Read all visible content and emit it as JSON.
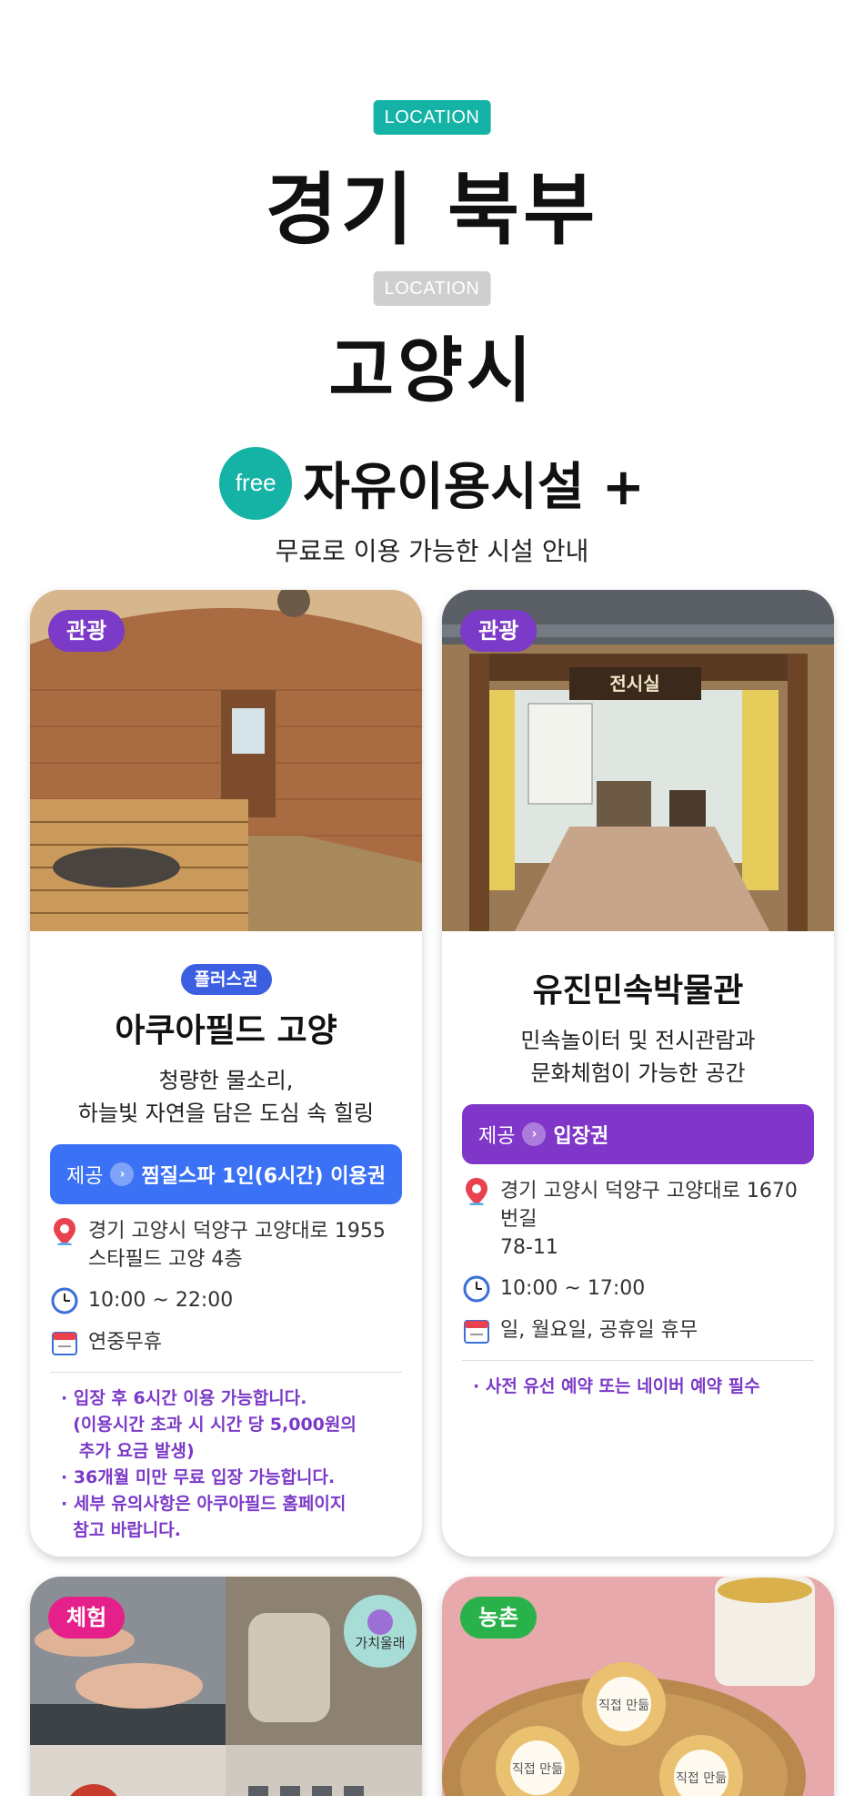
{
  "header": {
    "location_badge": "LOCATION",
    "region": "경기 북부",
    "sub_location_badge": "LOCATION",
    "city": "고양시"
  },
  "section": {
    "free_badge": "free",
    "title": "자유이용시설 +",
    "subtitle": "무료로 이용 가능한 시설 안내"
  },
  "cards": [
    {
      "category": "관광",
      "plus_badge": "플러스권",
      "name": "아쿠아필드 고양",
      "desc_line1": "청량한 물소리,",
      "desc_line2": "하늘빛 자연을 담은 도심 속 힐링",
      "offer_label": "제공",
      "offer_text": "찜질스파 1인(6시간) 이용권",
      "address_line1": "경기 고양시 덕양구 고양대로 1955",
      "address_line2": "스타필드 고양 4층",
      "hours": "10:00 ~ 22:00",
      "closed": "연중무휴",
      "notes": [
        "· 입장 후 6시간 이용 가능합니다.",
        "  (이용시간 초과 시 시간 당 5,000원의",
        "   추가 요금 발생)",
        "· 36개월 미만 무료 입장 가능합니다.",
        "· 세부 유의사항은 아쿠아필드 홈페이지",
        "  참고 바랍니다."
      ]
    },
    {
      "category": "관광",
      "image_sign": "전시실",
      "name": "유진민속박물관",
      "desc_line1": "민속놀이터 및 전시관람과",
      "desc_line2": "문화체험이 가능한 공간",
      "offer_label": "제공",
      "offer_text": "입장권",
      "address_line1": "경기 고양시 덕양구 고양대로 1670번길",
      "address_line2": "78-11",
      "hours": "10:00 ~ 17:00",
      "closed": "일, 월요일, 공휴일 휴무",
      "notes": [
        "· 사전 유선 예약 또는 네이버 예약 필수"
      ]
    },
    {
      "category": "체험",
      "image_sign": "가치울래"
    },
    {
      "category": "농촌",
      "image_sign1": "직접 만듦",
      "image_sign2": "직접 만듦",
      "image_sign3": "직접 만듦"
    }
  ],
  "colors": {
    "teal": "#14b3a5",
    "purple": "#7b3ac7",
    "blue": "#3b72f5",
    "pink": "#e5208a",
    "green": "#2ab24a"
  }
}
